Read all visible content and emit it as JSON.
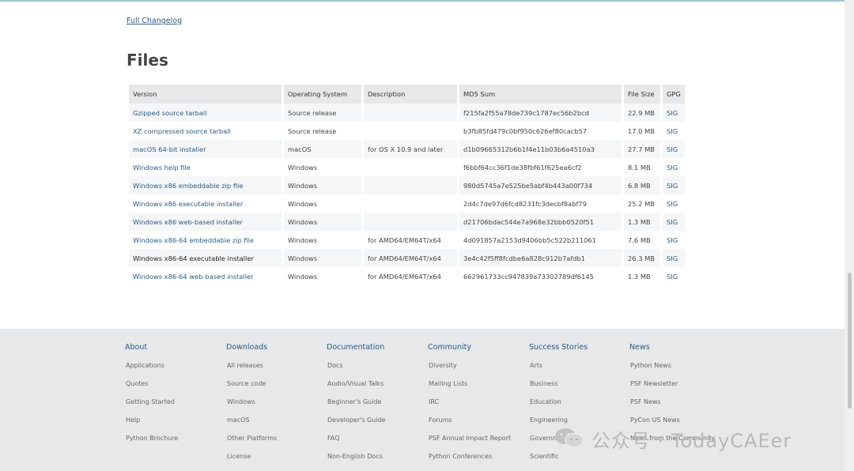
{
  "changelog_link": "Full Changelog",
  "files_title": "Files",
  "table": {
    "headers": [
      "Version",
      "Operating System",
      "Description",
      "MD5 Sum",
      "File Size",
      "GPG"
    ],
    "rows": [
      {
        "version": "Gzipped source tarball",
        "os": "Source release",
        "desc": "",
        "md5": "f215fa2f55a78de739c1787ec56b2bcd",
        "size": "22.9 MB",
        "gpg": "SIG"
      },
      {
        "version": "XZ compressed source tarball",
        "os": "Source release",
        "desc": "",
        "md5": "b3fb85fd479c0bf950c626ef80cacb57",
        "size": "17.0 MB",
        "gpg": "SIG"
      },
      {
        "version": "macOS 64-bit installer",
        "os": "macOS",
        "desc": "for OS X 10.9 and later",
        "md5": "d1b09665312b6b1f4e11b03b6a4510a3",
        "size": "27.7 MB",
        "gpg": "SIG"
      },
      {
        "version": "Windows help file",
        "os": "Windows",
        "desc": "",
        "md5": "f6bbf64cc36f1de38fbf61f625ea6cf2",
        "size": "8.1 MB",
        "gpg": "SIG"
      },
      {
        "version": "Windows x86 embeddable zip file",
        "os": "Windows",
        "desc": "",
        "md5": "980d5745a7e525be5abf4b443a00f734",
        "size": "6.8 MB",
        "gpg": "SIG"
      },
      {
        "version": "Windows x86 executable installer",
        "os": "Windows",
        "desc": "",
        "md5": "2d4c7de97d6fcd8231fc3decbf8abf79",
        "size": "25.2 MB",
        "gpg": "SIG"
      },
      {
        "version": "Windows x86 web-based installer",
        "os": "Windows",
        "desc": "",
        "md5": "d21706bdac544e7a968e32bbb0520f51",
        "size": "1.3 MB",
        "gpg": "SIG"
      },
      {
        "version": "Windows x86-64 embeddable zip file",
        "os": "Windows",
        "desc": "for AMD64/EM64T/x64",
        "md5": "4d091857a2153d9406bb5c522b211061",
        "size": "7.6 MB",
        "gpg": "SIG"
      },
      {
        "version": "Windows x86-64 executable installer",
        "os": "Windows",
        "desc": "for AMD64/EM64T/x64",
        "md5": "3e4c42f5ff8fcdbe6a828c912b7afdb1",
        "size": "26.3 MB",
        "gpg": "SIG"
      },
      {
        "version": "Windows x86-64 web-based installer",
        "os": "Windows",
        "desc": "for AMD64/EM64T/x64",
        "md5": "662961733cc947839a73302789df6145",
        "size": "1.3 MB",
        "gpg": "SIG"
      }
    ]
  },
  "footer": {
    "columns": [
      {
        "title": "About",
        "items": [
          "Applications",
          "Quotes",
          "Getting Started",
          "Help",
          "Python Brochure"
        ]
      },
      {
        "title": "Downloads",
        "items": [
          "All releases",
          "Source code",
          "Windows",
          "macOS",
          "Other Platforms",
          "License"
        ]
      },
      {
        "title": "Documentation",
        "items": [
          "Docs",
          "Audio/Visual Talks",
          "Beginner's Guide",
          "Developer's Guide",
          "FAQ",
          "Non-English Docs"
        ]
      },
      {
        "title": "Community",
        "items": [
          "Diversity",
          "Mailing Lists",
          "IRC",
          "Forums",
          "PSF Annual Impact Report",
          "Python Conferences"
        ]
      },
      {
        "title": "Success Stories",
        "items": [
          "Arts",
          "Business",
          "Education",
          "Engineering",
          "Government",
          "Scientific"
        ]
      },
      {
        "title": "News",
        "items": [
          "Python News",
          "PSF Newsletter",
          "PSF News",
          "PyCon US News",
          "News from the Community"
        ]
      }
    ]
  },
  "watermark": {
    "text": "公众号 · TodayCAEer",
    "icon": "wechat-icon"
  },
  "colors": {
    "link": "#2b5b84",
    "footer_bg": "#e6e8ea",
    "header_bg": "#e6e8ea",
    "row_alt": "#f5f6f7"
  }
}
